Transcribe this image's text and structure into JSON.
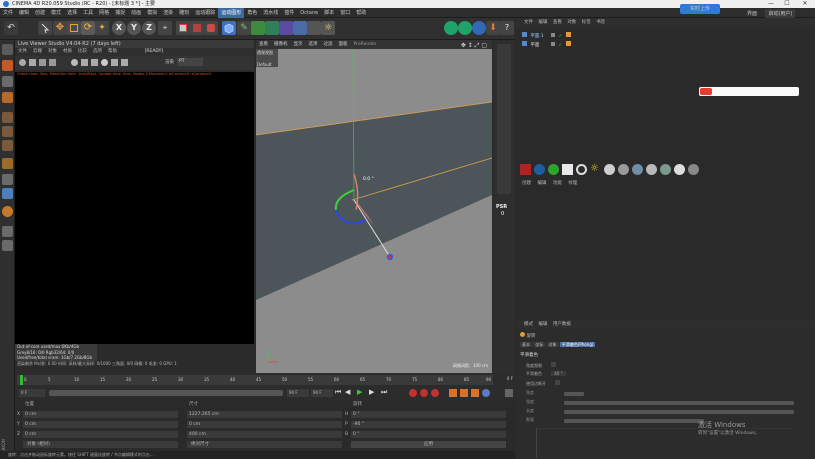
{
  "window": {
    "title": "CINEMA 4D R20.059 Studio (RC - R20) - [未标题 3 *] - 主要",
    "controls": [
      "—",
      "☐",
      "✕"
    ]
  },
  "menubar": [
    "文件",
    "编辑",
    "创建",
    "模式",
    "选择",
    "工具",
    "网格",
    "捕捉",
    "动画",
    "模拟",
    "渲染",
    "雕刻",
    "运动跟踪",
    "运动图形",
    "角色",
    "流水线",
    "插件",
    "Octane",
    "脚本",
    "窗口",
    "帮助"
  ],
  "menubar_highlight": 13,
  "share_button": "实时上传",
  "layout": {
    "label": "界面",
    "value": "启动(用户)"
  },
  "ipr": {
    "title": "Live Viewer Studio V4.04-R2 (7 days left)",
    "menu": [
      "文件",
      "云端",
      "对象",
      "材质",
      "比较",
      "选项",
      "帮助"
    ],
    "status": "[READY]",
    "message": "Check time: 3ms, MeshGen time: 1ms(0fps), Update time: 0ms, Nodes:3 Movable:0 txCached:0 rsCamera:0",
    "renderer_label": "渲染",
    "renderer_value": "PT",
    "stats": [
      "Out-of-core used/max:0Kb/4Gb",
      "Grey8/16: 0/0        Rgb32/64: 0/0",
      "Used/free/total vram: 1Gb/7.2Gb/8Gb"
    ],
    "footer": [
      "渲染剩余",
      "Ms/秒:",
      "0.00",
      "时间:",
      "采样/最大采样:",
      "0/1000",
      "三角面: 0/0",
      "网格: 0",
      "毛发: 0",
      "GPU:",
      "1"
    ]
  },
  "viewport": {
    "menu": [
      "查看",
      "摄像机",
      "显示",
      "选项",
      "过滤",
      "面板",
      "ProRender"
    ],
    "panel": [
      "透视视图",
      "Default"
    ],
    "angle_label": "0.0 °",
    "grid_label": "网格间距：100 cm",
    "prs": "PSR",
    "prs_value": "0"
  },
  "timeline": {
    "ticks": [
      "0",
      "5",
      "10",
      "15",
      "20",
      "25",
      "30",
      "35",
      "40",
      "45",
      "50",
      "55",
      "60",
      "65",
      "70",
      "75",
      "80",
      "85",
      "90"
    ],
    "current": "0 F",
    "start": "0 F",
    "end": "90 F",
    "end2": "90 F"
  },
  "coordinates": {
    "headers": [
      "位置",
      "尺寸",
      "旋转"
    ],
    "rows": [
      {
        "axis": "X",
        "pos": "0 cm",
        "size": "1227.265 cm",
        "rot_axis": "H",
        "rot": "0 °"
      },
      {
        "axis": "Y",
        "pos": "0 cm",
        "size": "0 cm",
        "rot_axis": "P",
        "rot": "-90 °"
      },
      {
        "axis": "Z",
        "pos": "0 cm",
        "size": "400 cm",
        "rot_axis": "B",
        "rot": "0 °"
      }
    ],
    "mode_left": "对象 (相对)",
    "mode_mid": "绝对尺寸",
    "apply": "应用"
  },
  "object_manager": {
    "tabs": [
      "文件",
      "编辑",
      "查看",
      "对象",
      "标签",
      "书签"
    ],
    "objects": [
      {
        "name": "平面.1"
      },
      {
        "name": "平面"
      }
    ]
  },
  "material_manager": {
    "tabs": [
      "创建",
      "编辑",
      "功能",
      "纹理"
    ]
  },
  "attribute_manager": {
    "tabs": [
      "模式",
      "编辑",
      "用户数据"
    ],
    "object_name": "旋转",
    "subtabs": [
      "基本",
      "坐标",
      "对象",
      "平滑着色(Phong)"
    ],
    "section": "平滑着色",
    "fields": [
      {
        "label": "角度限制",
        "value": ""
      },
      {
        "label": "平滑着色",
        "value": "40 °"
      },
      {
        "label": "使用边断开",
        "value": ""
      }
    ],
    "rows": [
      "角度",
      "强度",
      "长度",
      "数量"
    ]
  },
  "watermark": {
    "line1": "激活 Windows",
    "line2": "转到\"设置\"以激活 Windows。"
  },
  "status_bar": "旋转：点击并拖动鼠标旋转元素。按住 SHIFT 键量化旋转 / 节点编辑模式时点击..."
}
